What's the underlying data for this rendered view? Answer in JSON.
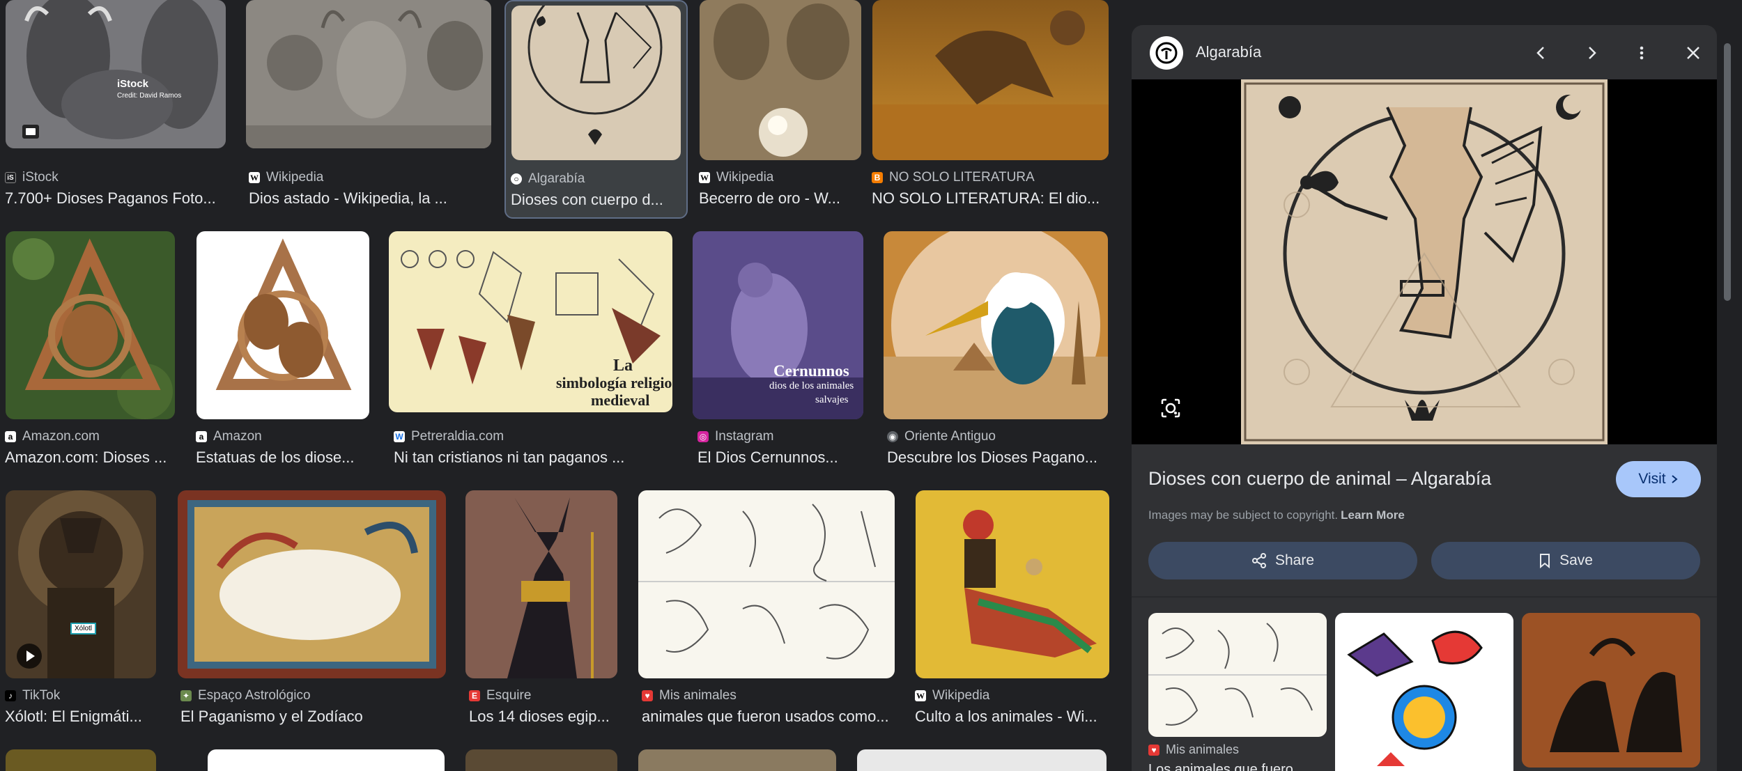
{
  "grid": {
    "row1": [
      {
        "source": "iStock",
        "title": "7.700+ Dioses Paganos Foto...",
        "overlay1": "iStock",
        "overlay2": "Credit: David Ramos"
      },
      {
        "source": "Wikipedia",
        "title": "Dios astado - Wikipedia, la ..."
      },
      {
        "source": "Algarabía",
        "title": "Dioses con cuerpo d..."
      },
      {
        "source": "Wikipedia",
        "title": "Becerro de oro - W..."
      },
      {
        "source": "NO SOLO LITERATURA",
        "title": "NO SOLO LITERATURA: El dio..."
      }
    ],
    "row2": [
      {
        "source": "Amazon.com",
        "title": "Amazon.com: Dioses ..."
      },
      {
        "source": "Amazon",
        "title": "Estatuas de los diose..."
      },
      {
        "source": "Petreraldia.com",
        "title": "Ni tan cristianos ni tan paganos ...",
        "overlay1": "La",
        "overlay2": "simbología religiosa",
        "overlay3": "medieval"
      },
      {
        "source": "Instagram",
        "title": "El Dios Cernunnos...",
        "overlay1": "Cernunnos",
        "overlay2": "dios de los animales",
        "overlay3": "salvajes"
      },
      {
        "source": "Oriente Antiguo",
        "title": "Descubre los Dioses Pagano..."
      }
    ],
    "row3": [
      {
        "source": "TikTok",
        "title": "Xólotl: El Enigmáti...",
        "overlay1": "Xólotl"
      },
      {
        "source": "Espaço Astrológico",
        "title": "El Paganismo y el Zodíaco"
      },
      {
        "source": "Esquire",
        "title": "Los 14 dioses egip..."
      },
      {
        "source": "Mis animales",
        "title": "animales que fueron usados como..."
      },
      {
        "source": "Wikipedia",
        "title": "Culto a los animales - Wi..."
      }
    ]
  },
  "panel": {
    "site": "Algarabía",
    "title": "Dioses con cuerpo de animal – Algarabía",
    "visit_label": "Visit",
    "copyright": "Images may be subject to copyright.",
    "learn_more": "Learn More",
    "share_label": "Share",
    "save_label": "Save",
    "related": [
      {
        "source": "Mis animales",
        "title": "Los animales que fuero..."
      }
    ]
  },
  "colors": {
    "background": "#202124",
    "panel": "#303134",
    "visit": "#a8c7fa",
    "action": "#3c4a62"
  }
}
